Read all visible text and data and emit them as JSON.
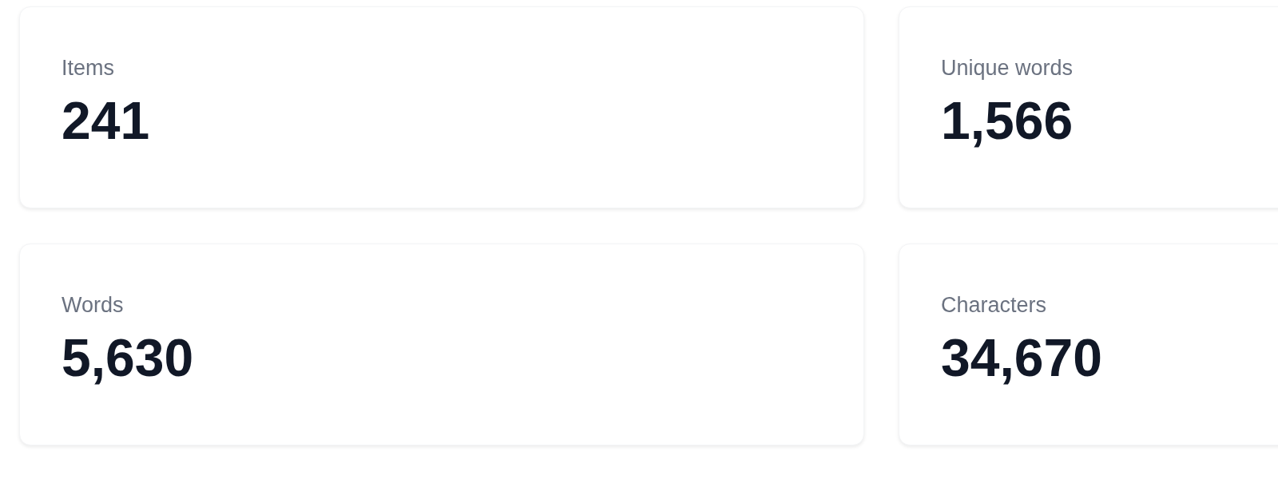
{
  "stats": [
    {
      "label": "Items",
      "value": "241"
    },
    {
      "label": "Unique words",
      "value": "1,566"
    },
    {
      "label": "Words",
      "value": "5,630"
    },
    {
      "label": "Characters",
      "value": "34,670"
    }
  ]
}
